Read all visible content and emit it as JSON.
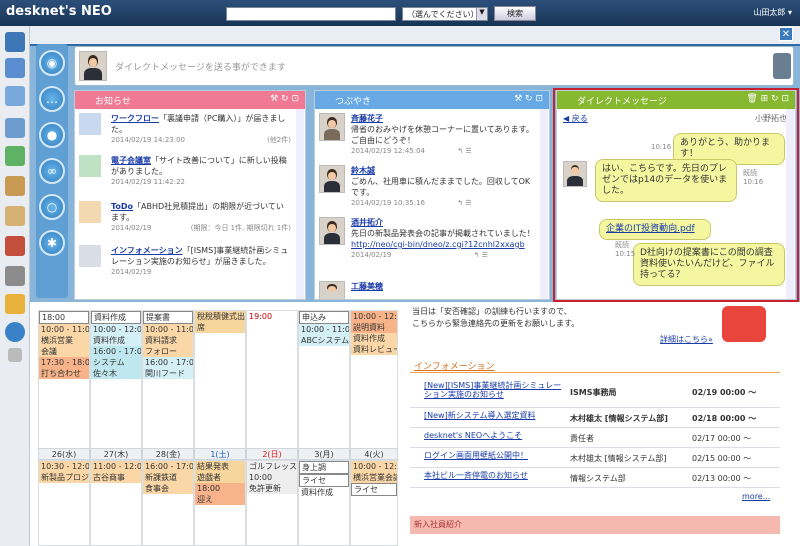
{
  "app": {
    "logo": "desknet's NEO",
    "select_label": "（選んでください）",
    "search_button": "検索",
    "user_name": "山田太郎 ▾"
  },
  "dm_bar": {
    "placeholder": "ダイレクトメッセージを送る事ができます"
  },
  "notice": {
    "title": "お知らせ",
    "items": [
      {
        "title": "ワークフロー",
        "text": "「裏議申請（PC購入）」が届きました。",
        "date": "2014/02/19 14:23:00",
        "extra": "(他2件)"
      },
      {
        "title": "電子会議室",
        "text": "「サイト改善について」に新しい投稿がありました。",
        "date": "2014/02/19 11:42:22",
        "extra": ""
      },
      {
        "title": "ToDo",
        "text": "「ABHD社見積提出」の期限が近づいています。",
        "date": "2014/02/19",
        "extra": "(期限：今日 1件, 期限切れ 1件)"
      },
      {
        "title": "インフォメーション",
        "text": "「[ISMS]事業継続計画シミュレーション実施のお知らせ」が届きました。",
        "date": "2014/02/19",
        "extra": ""
      }
    ]
  },
  "tweets": {
    "title": "つぶやき",
    "items": [
      {
        "name": "斉藤花子",
        "text": "帰省のおみやげを休憩コーナーに置いてあります。ご自由にどうぞ！",
        "date": "2014/02/19 12:45:04"
      },
      {
        "name": "鈴木誠",
        "text": "ごめん、社用車に積んだままでした。回収してOKです。",
        "date": "2014/02/19 10:35:16"
      },
      {
        "name": "酒井拓介",
        "text": "先日の新製品発表会の記事が掲載されていました！",
        "link": "http://neo/cgi-bin/dneo/z.cgi?12cnhl2xxagb",
        "date": "2014/02/19"
      },
      {
        "name": "工藤美穂",
        "text": "",
        "date": ""
      }
    ]
  },
  "dm": {
    "title": "ダイレクトメッセージ",
    "back": "戻る",
    "partner": "小野拓也",
    "messages": [
      {
        "text": "ありがとう、助かります！",
        "time": "10:16",
        "side": "right"
      },
      {
        "text": "はい、こちらです。先日のプレゼンではp14のデータを使いました。",
        "time": "10:16",
        "read": "既読",
        "side": "left"
      },
      {
        "text": "企業のIT投資動向.pdf",
        "side": "left",
        "link": true
      },
      {
        "text": "D社向けの提案書にこの間の調査資料使いたいんだけど、ファイル持ってる？",
        "time": "10:15",
        "read": "既読",
        "side": "right"
      }
    ]
  },
  "calendar": {
    "row1": [
      {
        "events": [
          "18:00",
          "10:00 - 11:00",
          "横浜営業",
          "会議",
          "17:30 - 18:00",
          "打ち合わせ"
        ]
      },
      {
        "events": [
          "資料作成",
          "10:00 - 12:00",
          "資料作成",
          "16:00 - 17:00",
          "システム",
          "佐々木"
        ]
      },
      {
        "events": [
          "提案書",
          "10:00 - 11:00",
          "資料請求",
          "フォロー",
          "16:00 - 17:00",
          "関川フード"
        ]
      },
      {
        "events": [
          "稅稅積健式出",
          "席"
        ]
      },
      {
        "events": [
          "19:00"
        ]
      },
      {
        "events": [
          "申込み",
          "10:00 - 11:00",
          "ABCシステム"
        ]
      },
      {
        "events": [
          "10:00 - 12:00",
          "説明資料",
          "資料作成",
          "資料レビュー"
        ]
      }
    ],
    "days": [
      "26(水)",
      "27(木)",
      "28(金)",
      "1(土)",
      "2(日)",
      "3(月)",
      "4(火)"
    ],
    "row2": [
      {
        "events": [
          "10:30 - 12:00",
          "新製品プロジェクト"
        ]
      },
      {
        "events": [
          "11:00 - 12:00",
          "古谷商事"
        ]
      },
      {
        "events": [
          "16:00 - 17:00",
          "新課鉄道",
          "食事会"
        ]
      },
      {
        "events": [
          "結果発表",
          "遊戯者",
          "18:00",
          "迎え"
        ]
      },
      {
        "events": [
          "ゴルフレッスン",
          "10:00",
          "免許更新"
        ]
      },
      {
        "events": [
          "身上調",
          "ライセ",
          "資料作成"
        ]
      },
      {
        "events": [
          "10:00 - 12:00",
          "横浜営業会議",
          "ライセ"
        ]
      }
    ]
  },
  "announce": {
    "line1": "当日は「安否確認」の訓練も行いますので、",
    "line2": "こちらから緊急連絡先の更新をお願いします。",
    "link": "詳細はこちら»"
  },
  "information": {
    "title": "インフォメーション",
    "rows": [
      {
        "title": "[New][ISMS]事業継続計画シミュレーション実施のお知らせ",
        "who": "ISMS事務局",
        "date": "02/19 00:00 ～",
        "new": true
      },
      {
        "title": "[New]新システム導入選定資料",
        "who": "木村雄太 [情報システム部]",
        "date": "02/18 00:00 ～",
        "new": true
      },
      {
        "title": "desknet's NEOへようこそ",
        "who": "責任者",
        "date": "02/17 00:00 ～",
        "new": false
      },
      {
        "title": "ログイン画面用壁紙公開中！",
        "who": "木村雄太 [情報システム部]",
        "date": "02/15 00:00 ～",
        "new": false
      },
      {
        "title": "本社ビル一斉停電のお知らせ",
        "who": "情報システム部",
        "date": "02/13 00:00 ～",
        "new": false
      }
    ],
    "more": "more..."
  },
  "new_staff": {
    "title": "新入社員紹介"
  },
  "colors": {
    "notice": "#f07a93",
    "tweets": "#67a9e5",
    "dm": "#86b830",
    "accent": "#2e6aa3"
  }
}
